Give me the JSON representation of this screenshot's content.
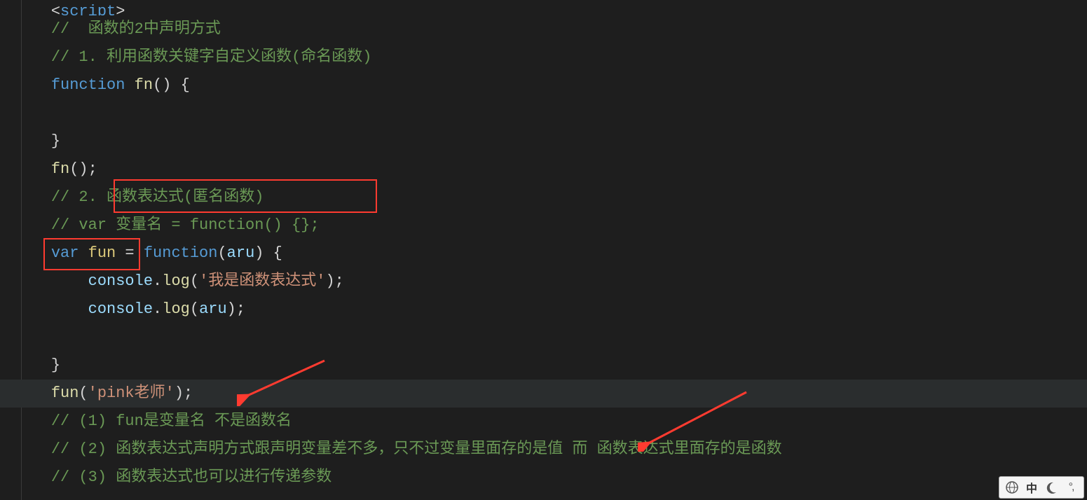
{
  "code": {
    "line0_script_open": "<script>",
    "line1_comment": "//  函数的2中声明方式",
    "line2_comment": "// 1. 利用函数关键字自定义函数(命名函数)",
    "line3_function_kw": "function",
    "line3_fn_name": "fn",
    "line3_params_open": "()",
    "line3_brace_open": " {",
    "line4_empty": "",
    "line5_close_brace": "}",
    "line6_call_fn": "fn",
    "line6_call_paren": "();",
    "line7_comment_prefix": "// 2. ",
    "line7_comment_boxed": "函数表达式(匿名函数)",
    "line8_comment": "// var 变量名 = function() {};",
    "line9_var": "var",
    "line9_ident": "fun",
    "line9_eq": " = ",
    "line9_function_kw": "function",
    "line9_params_open": "(",
    "line9_param": "aru",
    "line9_params_close": ")",
    "line9_brace_open": " {",
    "line10_console": "console",
    "line10_dot": ".",
    "line10_log": "log",
    "line10_open": "(",
    "line10_str": "'我是函数表达式'",
    "line10_close": ");",
    "line11_console": "console",
    "line11_dot": ".",
    "line11_log": "log",
    "line11_open": "(",
    "line11_arg": "aru",
    "line11_close": ");",
    "line12_empty": "",
    "line13_close_brace": "}",
    "line14_call_fun": "fun",
    "line14_open": "(",
    "line14_str": "'pink老师'",
    "line14_close": ");",
    "line15_comment": "// (1) fun是变量名 不是函数名",
    "line16_comment": "// (2) 函数表达式声明方式跟声明变量差不多，只不过变量里面存的是值 而 函数表达式里面存的是函数",
    "line17_comment": "// (3) 函数表达式也可以进行传递参数"
  },
  "annotations": {
    "redbox1": "函数表达式(匿名函数)",
    "redbox2": "var fun",
    "arrow1": "arrow-left",
    "arrow2": "arrow-left"
  },
  "ime": {
    "globe": "globe-icon",
    "lang": "中",
    "moon": "moon-icon",
    "more": "more-icon"
  }
}
